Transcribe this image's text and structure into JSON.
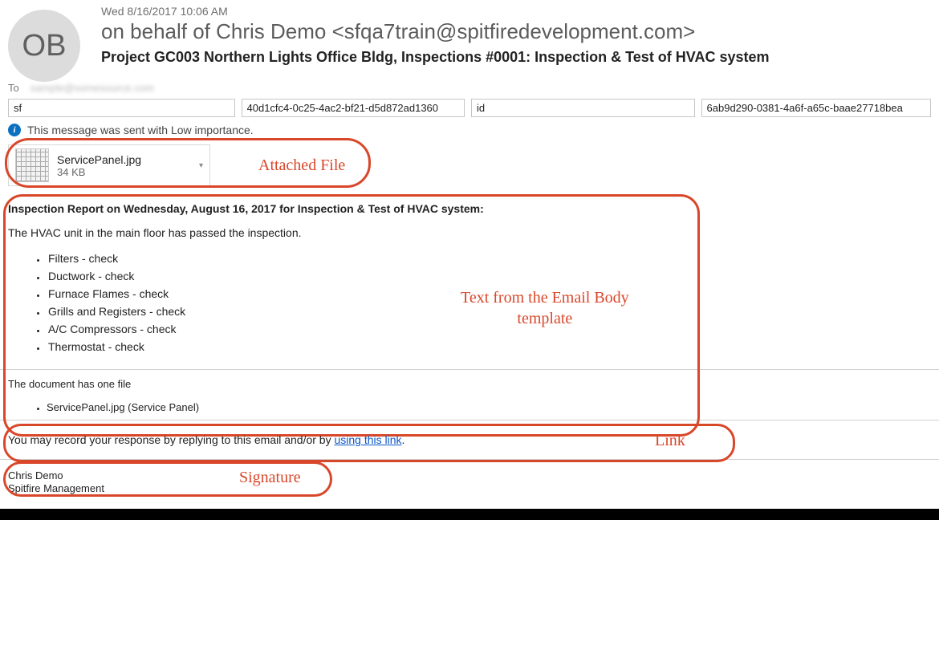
{
  "header": {
    "avatar_initials": "OB",
    "date": "Wed 8/16/2017 10:06 AM",
    "from": "on behalf of Chris Demo <sfqa7train@spitfiredevelopment.com>",
    "subject": "Project GC003 Northern Lights Office Bldg, Inspections #0001: Inspection & Test of HVAC system",
    "to_label": "To",
    "to_value": "sample@somesource.com"
  },
  "metadata_fields": {
    "f1_label": "sf",
    "f1_value": "40d1cfc4-0c25-4ac2-bf21-d5d872ad1360",
    "f2_label": "id",
    "f2_value": "6ab9d290-0381-4a6f-a65c-baae27718bea"
  },
  "importance_notice": "This message was sent with Low importance.",
  "attachment": {
    "filename": "ServicePanel.jpg",
    "size": "34 KB"
  },
  "annotations": {
    "attached": "Attached File",
    "body": "Text from the Email Body template",
    "link": "Link",
    "signature": "Signature"
  },
  "body": {
    "report_title": "Inspection Report on Wednesday, August 16, 2017 for Inspection & Test of HVAC system:",
    "intro": "The HVAC unit in the main floor has passed the inspection.",
    "check_items": [
      "Filters - check",
      "Ductwork - check",
      "Furnace Flames - check",
      "Grills and Registers - check",
      "A/C Compressors - check",
      "Thermostat - check"
    ],
    "doc_files_intro": "The document has one file",
    "doc_files": [
      "ServicePanel.jpg (Service Panel)"
    ],
    "respond_prefix": "You may record your response by replying to this email and/or by ",
    "respond_link": "using this link",
    "respond_suffix": "."
  },
  "signature": {
    "name": "Chris Demo",
    "company": "Spitfire Management"
  }
}
